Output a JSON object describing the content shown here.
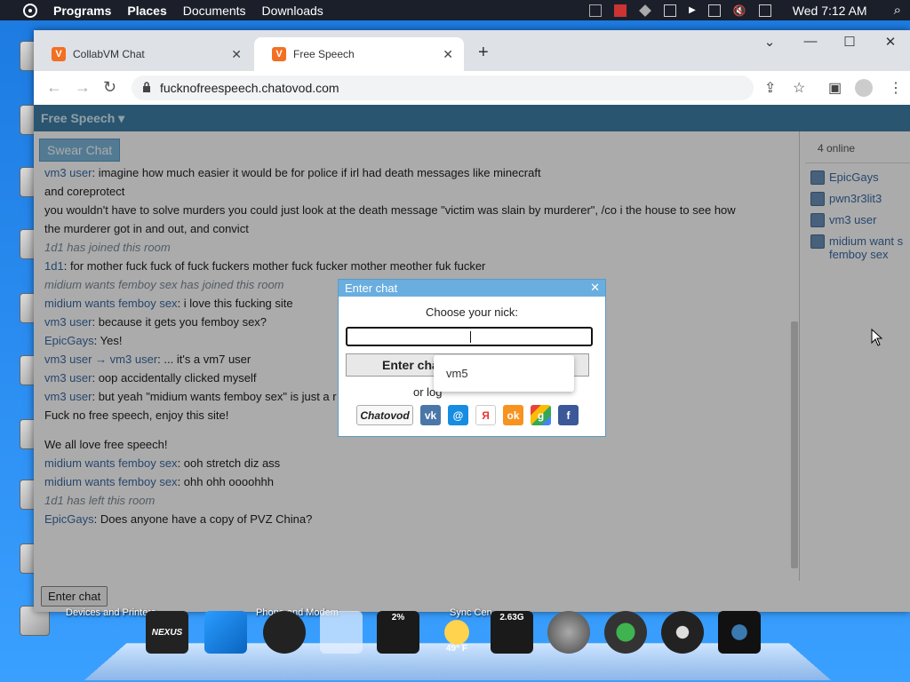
{
  "topbar": {
    "menus": [
      "Programs",
      "Places",
      "Documents",
      "Downloads"
    ],
    "clock": "Wed 7:12 AM"
  },
  "browser": {
    "tabs": [
      {
        "label": "CollabVM Chat",
        "favicon": "V"
      },
      {
        "label": "Free Speech",
        "favicon": "V"
      }
    ],
    "url": "fucknofreespeech.chatovod.com"
  },
  "site": {
    "header_title": "Free Speech ▾",
    "room_tab": "Swear Chat",
    "online_count": "4 online",
    "users": [
      {
        "name": "EpicGays"
      },
      {
        "name": "pwn3r3lit3"
      },
      {
        "name": "vm3 user"
      },
      {
        "name": "midium want s femboy sex"
      }
    ],
    "messages": [
      {
        "nick": "vm3 user",
        "text": "imagine how much easier it would be for police if irl had death messages like minecraft"
      },
      {
        "nick": "",
        "text": "and coreprotect"
      },
      {
        "nick": "",
        "text": "you wouldn't have to solve murders you could just look at the death message \"victim was slain by murderer\", /co i the house to see how"
      },
      {
        "nick": "",
        "text": "the murderer got in and out, and convict"
      },
      {
        "system": "1d1 has joined this room"
      },
      {
        "nick": "1d1",
        "text": "for mother fuck fuck of fuck fuckers mother fuck fucker mother meother fuk fucker"
      },
      {
        "system": "midium wants femboy sex has joined this room"
      },
      {
        "nick": "midium wants femboy sex",
        "text": "i love this fucking site"
      },
      {
        "nick": "vm3 user",
        "text": "because it gets you femboy sex?"
      },
      {
        "nick": "EpicGays",
        "text": "Yes!"
      },
      {
        "nick": "vm3 user → vm3 user",
        "text": "... it's a vm7 user"
      },
      {
        "nick": "vm3 user",
        "text": "oop accidentally clicked myself"
      },
      {
        "nick": "vm3 user",
        "text": "but yeah \"midium wants femboy sex\" is just a r"
      },
      {
        "nick": "",
        "text": "Fuck no free speech, enjoy this site!"
      },
      {
        "gap": true
      },
      {
        "nick": "",
        "text": "We all love free speech!"
      },
      {
        "nick": "midium wants femboy sex",
        "text": "ooh stretch diz ass"
      },
      {
        "nick": "midium wants femboy sex",
        "text": "ohh ohh oooohhh"
      },
      {
        "system": "1d1 has left this room"
      },
      {
        "nick": "EpicGays",
        "text": "Does anyone have a copy of PVZ China?"
      }
    ],
    "enter_chat_bottom": "Enter chat"
  },
  "dialog": {
    "title": "Enter chat",
    "prompt": "Choose your nick:",
    "nick_value": "",
    "enter_button": "Enter cha",
    "or_login": "or log",
    "autocomplete": "vm5",
    "social": [
      "Chatovod",
      "vk",
      "@",
      "Я",
      "ok",
      "g",
      "f"
    ]
  },
  "dock": {
    "labels": [
      "Devices and Printers",
      "Phone and Modem",
      "Sync Cen"
    ],
    "cpu": "2%",
    "weather": "49° F",
    "mem": "2.63G"
  }
}
